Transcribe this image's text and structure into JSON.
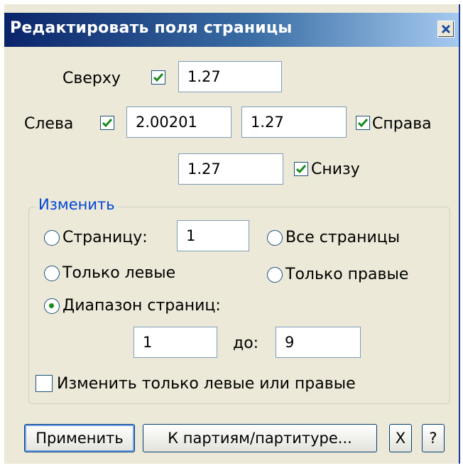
{
  "dialog": {
    "title": "Редактировать поля страницы"
  },
  "margins": {
    "top": {
      "label": "Сверху",
      "checked": true,
      "value": "1.27"
    },
    "left": {
      "label": "Слева",
      "checked": true,
      "value": "2.00201"
    },
    "right": {
      "label": "Справа",
      "checked": true,
      "value": "1.27"
    },
    "bottom": {
      "label": "Снизу",
      "checked": true,
      "value": "1.27"
    }
  },
  "change_group": {
    "title": "Изменить",
    "options": {
      "page": {
        "label": "Страницу:",
        "selected": false,
        "value": "1"
      },
      "all_pages": {
        "label": "Все страницы",
        "selected": false
      },
      "only_left": {
        "label": "Только левые",
        "selected": false
      },
      "only_right": {
        "label": "Только правые",
        "selected": false
      },
      "page_range": {
        "label": "Диапазон страниц:",
        "selected": true
      }
    },
    "range": {
      "from": "1",
      "to_label": "до:",
      "to": "9"
    },
    "left_or_right_only": {
      "label": "Изменить только левые или правые",
      "checked": false
    }
  },
  "buttons": {
    "apply": "Применить",
    "parts": "К партиям/партитуре...",
    "cancel": "X",
    "help": "?"
  },
  "colors": {
    "title_gradient_start": "#0a246a",
    "title_gradient_end": "#a6caf0",
    "check_mark": "#1a8a1a",
    "group_title": "#0046d5"
  }
}
